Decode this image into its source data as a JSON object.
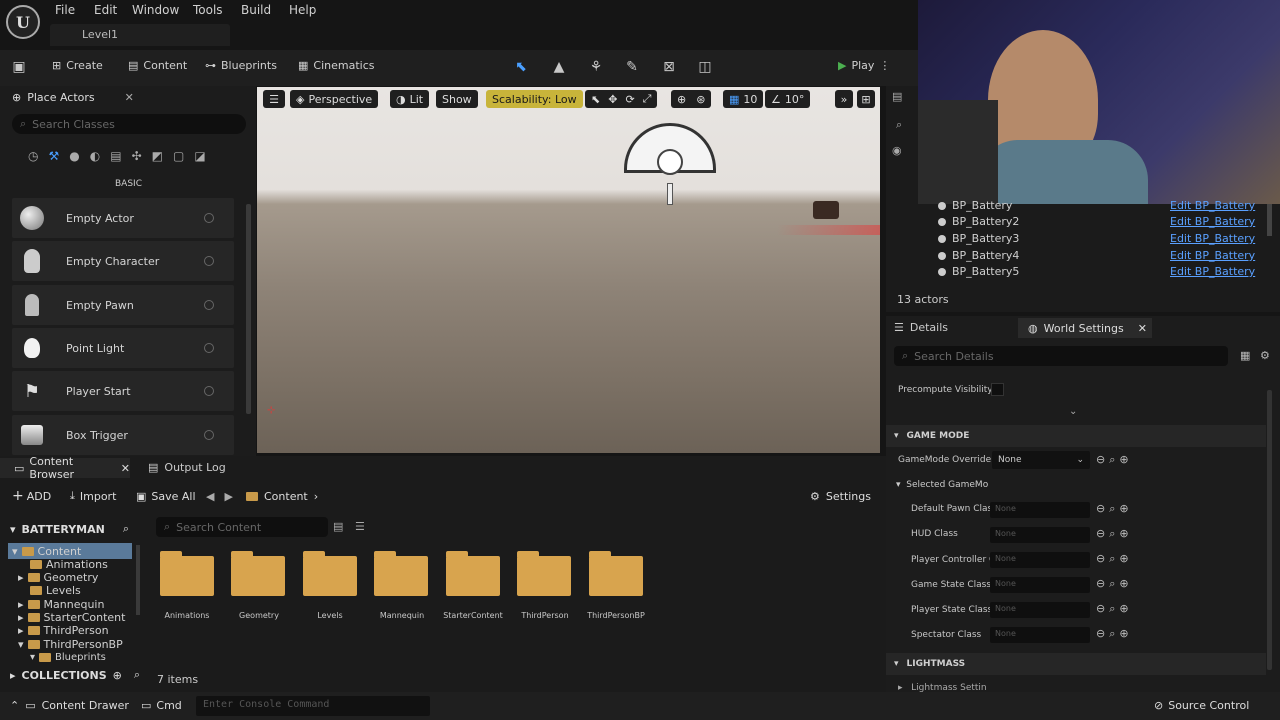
{
  "menu": [
    "File",
    "Edit",
    "Window",
    "Tools",
    "Build",
    "Help"
  ],
  "level_tab": "Level1",
  "toolbar": {
    "create": "Create",
    "content": "Content",
    "blueprints": "Blueprints",
    "cinematics": "Cinematics",
    "play": "Play"
  },
  "place_actors": {
    "title": "Place Actors",
    "search_placeholder": "Search Classes",
    "category": "BASIC",
    "items": [
      "Empty Actor",
      "Empty Character",
      "Empty Pawn",
      "Point Light",
      "Player Start",
      "Box Trigger"
    ]
  },
  "viewport": {
    "perspective": "Perspective",
    "lit": "Lit",
    "show": "Show",
    "scalability": "Scalability: Low",
    "grid_snap": "10",
    "rot_snap": "10°"
  },
  "outliner": {
    "rows": [
      {
        "name": "BP_Battery",
        "edit": "Edit BP_Battery"
      },
      {
        "name": "BP_Battery2",
        "edit": "Edit BP_Battery"
      },
      {
        "name": "BP_Battery3",
        "edit": "Edit BP_Battery"
      },
      {
        "name": "BP_Battery4",
        "edit": "Edit BP_Battery"
      },
      {
        "name": "BP_Battery5",
        "edit": "Edit BP_Battery"
      }
    ],
    "count": "13 actors"
  },
  "details": {
    "tab_details": "Details",
    "tab_world": "World Settings",
    "search_placeholder": "Search Details",
    "precompute": "Precompute Visibility",
    "section_game_mode": "GAME MODE",
    "gamemode_override_label": "GameMode Override",
    "gamemode_override_value": "None",
    "selected_gamemode": "Selected GameMo",
    "props": [
      "Default Pawn Clas",
      "HUD Class",
      "Player Controller C",
      "Game State Class",
      "Player State Class",
      "Spectator Class"
    ],
    "prop_value": "None",
    "section_lightmass": "LIGHTMASS",
    "lightmass_settings": "Lightmass Settin"
  },
  "content_browser": {
    "tab": "Content Browser",
    "output_log": "Output Log",
    "add": "ADD",
    "import": "Import",
    "save_all": "Save All",
    "path": "Content",
    "settings": "Settings",
    "project": "BATTERYMAN",
    "search_placeholder": "Search Content",
    "tree": [
      "Content",
      "Animations",
      "Geometry",
      "Levels",
      "Mannequin",
      "StarterContent",
      "ThirdPerson",
      "ThirdPersonBP",
      "Blueprints"
    ],
    "folders": [
      "Animations",
      "Geometry",
      "Levels",
      "Mannequin",
      "StarterContent",
      "ThirdPerson",
      "ThirdPersonBP"
    ],
    "items_count": "7 items",
    "collections": "COLLECTIONS"
  },
  "statusbar": {
    "drawer": "Content Drawer",
    "cmd": "Cmd",
    "console_placeholder": "Enter Console Command",
    "source_control": "Source Control"
  }
}
